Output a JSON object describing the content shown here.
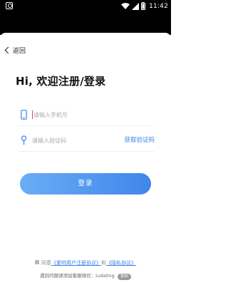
{
  "status_bar": {
    "time": "11:42"
  },
  "nav": {
    "back_label": "返回"
  },
  "title": "Hi, 欢迎注册/登录",
  "phone_field": {
    "placeholder": "请输入手机号",
    "value": ""
  },
  "code_field": {
    "placeholder": "请输入验证码",
    "value": "",
    "get_code_label": "获取验证码"
  },
  "login_button": {
    "label": "登录"
  },
  "agreement": {
    "prefix": "同意",
    "link1": "《爱哟用户注册协议》",
    "and": "和",
    "link2": "《隐私协议》"
  },
  "support": {
    "text": "遇到问题请添加客服微信：iudating",
    "copy_label": "复制"
  },
  "colors": {
    "accent": "#3a82e8",
    "button_start": "#6aadf6",
    "button_end": "#3f86ea",
    "status_bar": "#000000"
  },
  "icons": {
    "phone_field": "phone-icon",
    "code_field": "location-pin-icon",
    "back": "chevron-left-icon"
  }
}
